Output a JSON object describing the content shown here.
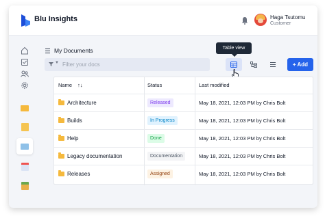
{
  "app": {
    "title": "Blu Insights",
    "brand_color": "#2563eb"
  },
  "user": {
    "name": "Haga Tsutomu",
    "role": "Customer"
  },
  "sidebar": {
    "nav_icons": [
      "home-icon",
      "checklist-icon",
      "users-icon",
      "settings-icon"
    ],
    "apps": [
      "folder-app-icon",
      "notes-app-icon",
      "image-app-icon",
      "calendar-app-icon",
      "chart-app-icon"
    ]
  },
  "header": {
    "title": "My Documents"
  },
  "filter": {
    "placeholder": "Filter your docs"
  },
  "view_switcher": {
    "tooltip": "Table view",
    "options": [
      "table-view",
      "tree-view",
      "list-view"
    ],
    "active": "table-view"
  },
  "toolbar": {
    "add_label": "+ Add"
  },
  "table": {
    "columns": {
      "name": "Name",
      "sort_icon": "↑↓",
      "status": "Status",
      "modified": "Last modified"
    },
    "rows": [
      {
        "name": "Architecture",
        "status": "Released",
        "status_color": "#7c3aed",
        "status_bg": "#ede9fe",
        "modified": "May 18, 2021, 12:03 PM by Chris Bolt"
      },
      {
        "name": "Builds",
        "status": "In Progress",
        "status_color": "#0284c7",
        "status_bg": "#e0f2fe",
        "modified": "May 18, 2021, 12:03 PM by Chris Bolt"
      },
      {
        "name": "Help",
        "status": "Done",
        "status_color": "#16a34a",
        "status_bg": "#dcfce7",
        "modified": "May 18, 2021, 12:03 PM by Chris Bolt"
      },
      {
        "name": "Legacy documentation",
        "status": "Documentation",
        "status_color": "#4b5563",
        "status_bg": "#f3f4f6",
        "modified": "May 18, 2021, 12:03 PM by Chris Bolt"
      },
      {
        "name": "Releases",
        "status": "Assigned",
        "status_color": "#92400e",
        "status_bg": "#fdf2e3",
        "modified": "May 18, 2021, 12:03 PM by Chris Bolt"
      }
    ]
  }
}
